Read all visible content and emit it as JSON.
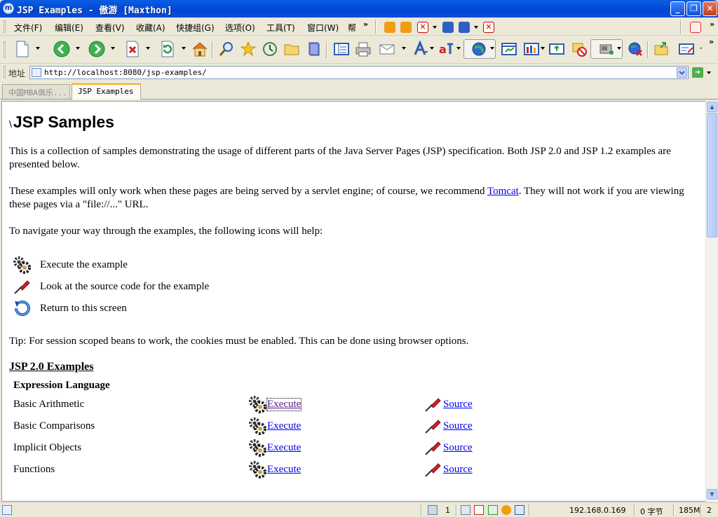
{
  "window": {
    "app_icon": "maxthon-logo-icon",
    "title": "JSP Examples - 傲游 [Maxthon]",
    "controls": [
      "minimize-icon",
      "restore-icon",
      "close-icon"
    ]
  },
  "menu": {
    "items": [
      "文件(F)",
      "编辑(E)",
      "查看(V)",
      "收藏(A)",
      "快捷组(G)",
      "选项(O)",
      "工具(T)",
      "窗口(W)",
      "帮"
    ],
    "overflow": "»"
  },
  "toolbar": {
    "icons": [
      "new-page-icon",
      "back-icon",
      "forward-icon",
      "stop-icon",
      "refresh-icon",
      "home-icon",
      "search-icon",
      "favorites-star-icon",
      "history-icon",
      "folder-icon",
      "book-icon",
      "sidebar-icon",
      "print-icon",
      "mail-icon",
      "font-size-icon",
      "translate-icon",
      "browser-globe-icon",
      "window-icon",
      "columns-icon",
      "screenshot-icon",
      "popup-block-icon",
      "proxy-icon",
      "network-icon",
      "open-folder-icon",
      "notepad-icon"
    ],
    "overflow": "»"
  },
  "address": {
    "label": "地址",
    "url": "http://localhost:8080/jsp-examples/"
  },
  "tabs": [
    {
      "label": "中国MBA俱乐...",
      "active": false
    },
    {
      "label": "JSP Examples",
      "active": true
    }
  ],
  "page": {
    "title_prefix": "\\",
    "title": "JSP Samples",
    "intro": "This is a collection of samples demonstrating the usage of different parts of the Java Server Pages (JSP) specification. Both JSP 2.0 and JSP 1.2 examples are presented below.",
    "servlet_before": "These examples will only work when these pages are being served by a servlet engine; of course, we recommend ",
    "servlet_link": "Tomcat",
    "servlet_after": ". They will not work if you are viewing these pages via a \"file://...\" URL.",
    "navigate": "To navigate your way through the examples, the following icons will help:",
    "legend": [
      {
        "icon": "gears-execute-icon",
        "text": "Execute the example"
      },
      {
        "icon": "screwdriver-source-icon",
        "text": "Look at the source code for the example"
      },
      {
        "icon": "return-arrow-icon",
        "text": "Return to this screen"
      }
    ],
    "tip": "Tip: For session scoped beans to work, the cookies must be enabled. This can be done using browser options.",
    "section": "JSP 2.0 Examples",
    "subsection": "Expression Language",
    "examples": [
      {
        "name": "Basic Arithmetic",
        "execute": "Execute",
        "source": "Source"
      },
      {
        "name": "Basic Comparisons",
        "execute": "Execute",
        "source": "Source"
      },
      {
        "name": "Implicit Objects",
        "execute": "Execute",
        "source": "Source"
      },
      {
        "name": "Functions",
        "execute": "Execute",
        "source": "Source"
      }
    ]
  },
  "status": {
    "download_count": "1",
    "ip": "192.168.0.169",
    "bytes": "0 字节",
    "memory": "185M",
    "count": "2"
  },
  "colors": {
    "title_bar": "#0a5ee3",
    "link": "#0000ee",
    "visited_link": "#551a8b",
    "tab_accent": "#f7a823"
  }
}
